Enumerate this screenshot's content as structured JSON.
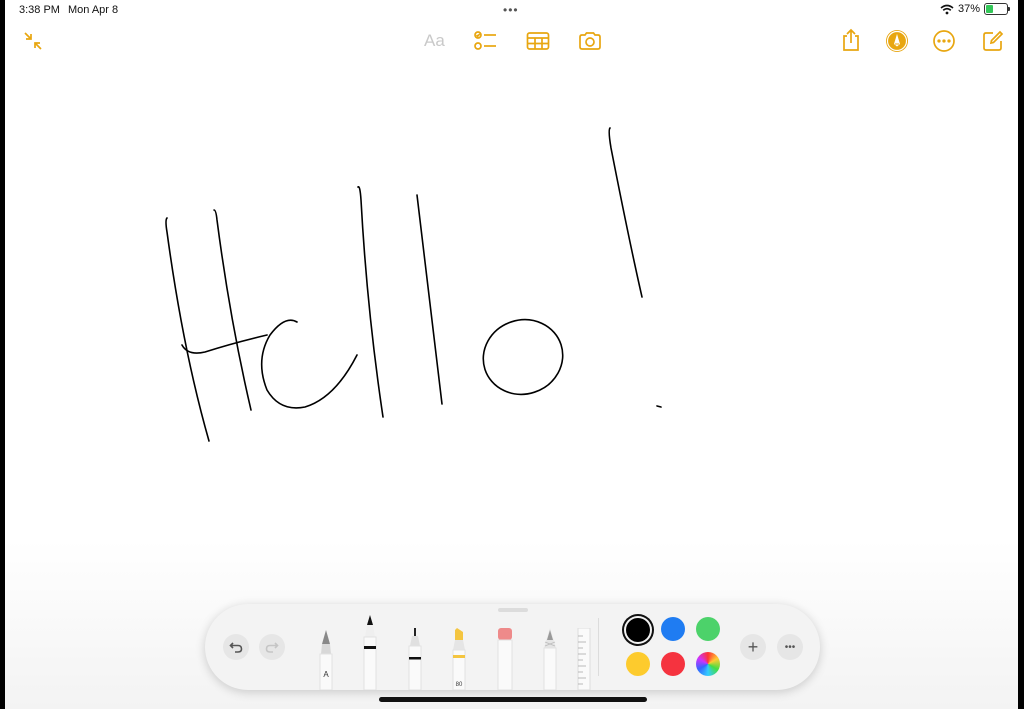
{
  "status_bar": {
    "time": "3:38 PM",
    "date": "Mon Apr 8",
    "battery_percent": "37%",
    "battery_level": 0.37,
    "multitask_dots": "•••"
  },
  "toolbar": {
    "format_label": "Aa",
    "accent_color": "#e8a610",
    "left_icons": [
      "collapse-icon"
    ],
    "center_icons": [
      "checklist-icon",
      "table-icon",
      "camera-icon"
    ],
    "right_icons": [
      "share-icon",
      "markup-icon",
      "more-icon",
      "compose-icon"
    ]
  },
  "canvas": {
    "ink_color": "#000000",
    "strokes": [
      "H",
      "e",
      "l",
      "l",
      "o",
      "!"
    ]
  },
  "tool_palette": {
    "tools": [
      "pen-tool",
      "monoline-tool",
      "fineliner-tool",
      "marker-tool",
      "eraser-tool",
      "pencil-tool",
      "ruler-tool"
    ],
    "pen_label": "A",
    "marker_label": "80",
    "selected_tool": "monoline-tool",
    "colors": [
      {
        "name": "black",
        "hex": "#000000",
        "selected": true
      },
      {
        "name": "blue",
        "hex": "#1f7cf2",
        "selected": false
      },
      {
        "name": "green",
        "hex": "#4cd26a",
        "selected": false
      },
      {
        "name": "yellow",
        "hex": "#fdcb2d",
        "selected": false
      },
      {
        "name": "red",
        "hex": "#f5333f",
        "selected": false
      },
      {
        "name": "multicolor",
        "hex": "conic",
        "selected": false
      }
    ],
    "add_label": "+",
    "more_label": "•••"
  }
}
